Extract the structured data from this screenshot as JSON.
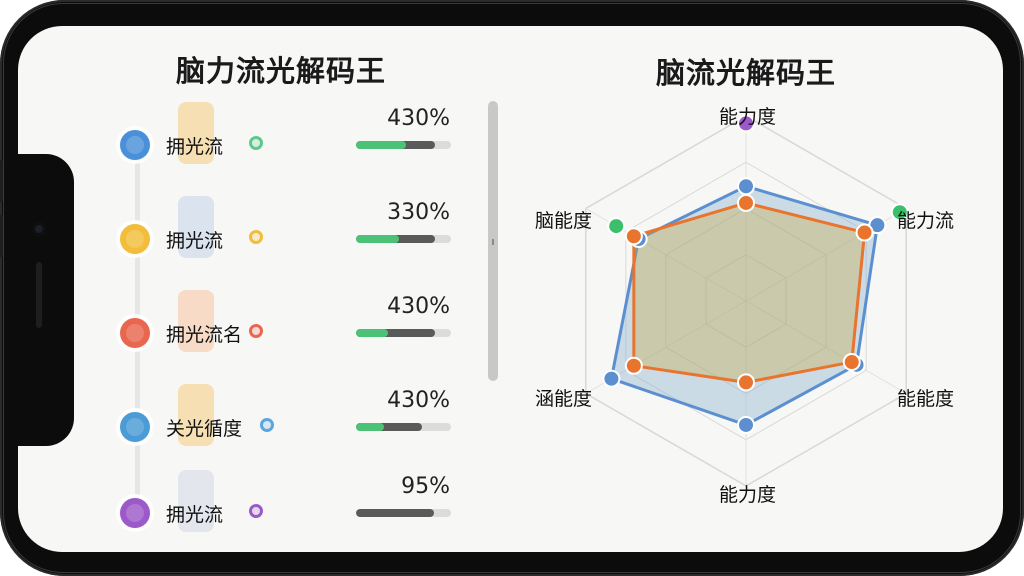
{
  "left_panel": {
    "title": "脑力流光解码王",
    "items": [
      {
        "label": "拥光流",
        "percent": "430%",
        "color": "#4a90d9",
        "small_color": "#5cc98a",
        "cyl_color": "#f5c361",
        "fill": 0.83,
        "green": 0.53
      },
      {
        "label": "拥光流",
        "percent": "330%",
        "color": "#f2bd3a",
        "small_color": "#f2bd3a",
        "cyl_color": "#b7c9e6",
        "fill": 0.83,
        "green": 0.45
      },
      {
        "label": "拥光流名",
        "percent": "430%",
        "color": "#e8674e",
        "small_color": "#e8674e",
        "cyl_color": "#f7b88b",
        "fill": 0.83,
        "green": 0.34
      },
      {
        "label": "关光循度",
        "percent": "430%",
        "color": "#4a9bd6",
        "small_color": "#5aa6de",
        "cyl_color": "#f5c361",
        "fill": 0.69,
        "green": 0.29
      },
      {
        "label": "拥光流",
        "percent": "95%",
        "color": "#9b59c9",
        "small_color": "#9b59c9",
        "cyl_color": "#c9d3e3",
        "fill": 0.82,
        "green": 0
      }
    ]
  },
  "radar": {
    "title": "脑流光解码王",
    "axes": [
      "能力度",
      "能力流",
      "能能度",
      "能力度",
      "涵能度",
      "脑能度"
    ],
    "grid_levels": [
      0.25,
      0.5,
      0.75,
      1.0
    ],
    "series": [
      {
        "color": "#5b8fd0",
        "fill": "rgba(120,165,200,0.35)",
        "values": [
          0.62,
          0.82,
          0.69,
          0.67,
          0.84,
          0.67
        ]
      },
      {
        "color": "#e8742e",
        "fill": "rgba(200,170,60,0.35)",
        "values": [
          0.53,
          0.74,
          0.66,
          0.44,
          0.7,
          0.7
        ]
      }
    ],
    "outer_points": [
      {
        "axis": 0,
        "value": 0.82,
        "color": "#9b59c9"
      },
      {
        "axis": 1,
        "value": 0.82,
        "color": "#3cbf6a"
      },
      {
        "axis": 5,
        "value": 0.67,
        "color": "#3cbf6a"
      }
    ]
  }
}
